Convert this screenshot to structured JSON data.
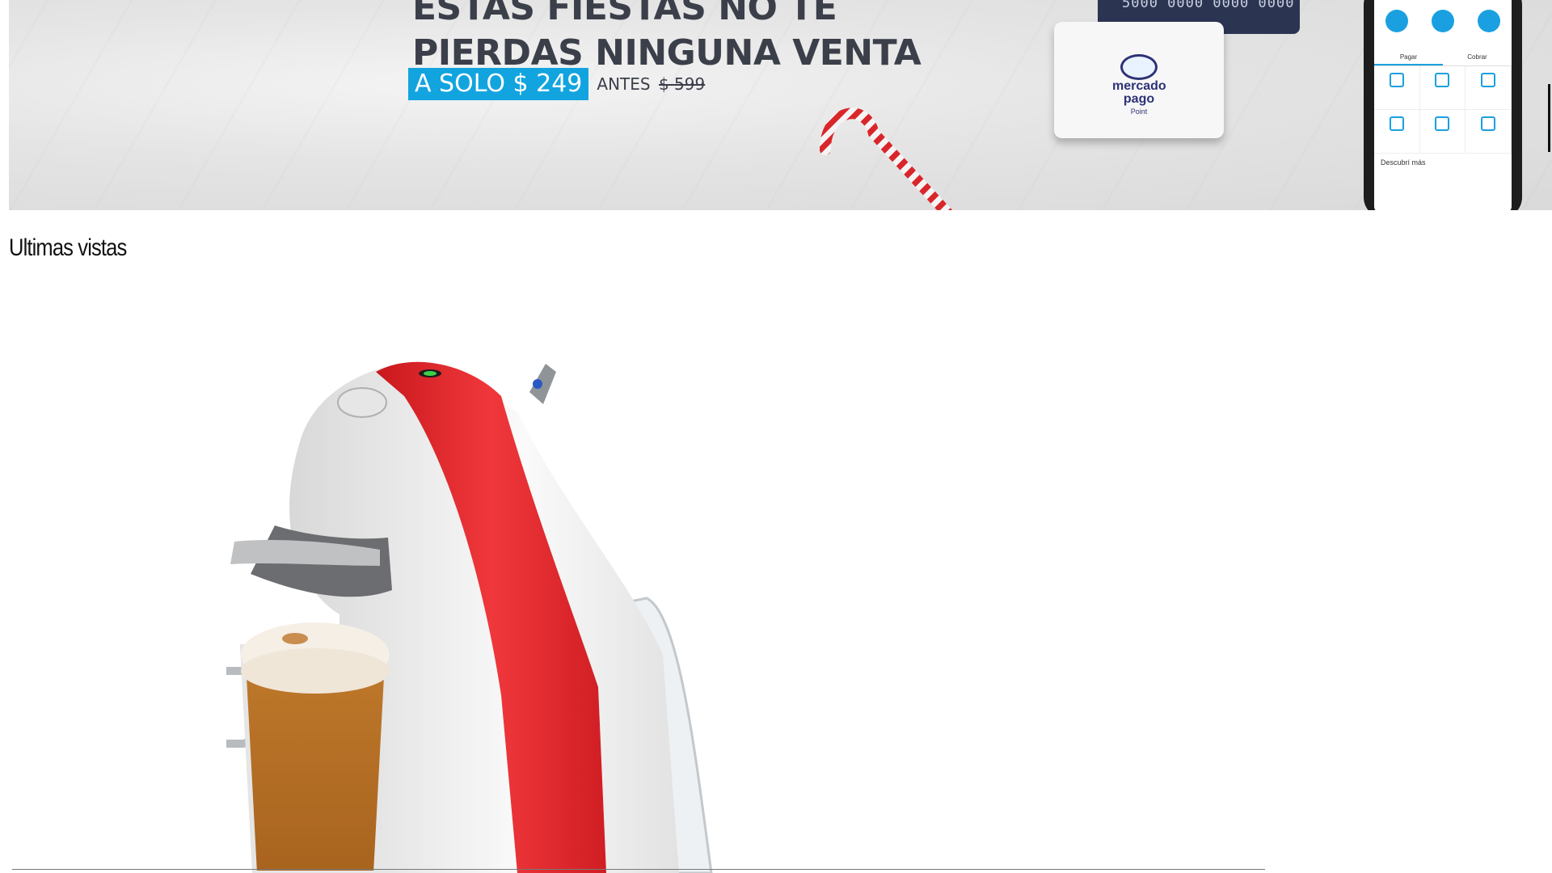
{
  "banner": {
    "headline_line1": "ESTAS FIESTAS NO TE",
    "headline_line2": "PIERDAS NINGUNA VENTA",
    "price_label": "A SOLO $ 249",
    "before_label": "ANTES",
    "before_price": "$ 599",
    "card_number": "5000 0000 0000 0000",
    "device_brand": "mercado",
    "device_brand2": "pago",
    "device_model": "Point",
    "phone_tab_pay": "Pagar",
    "phone_tab_charge": "Cobrar",
    "phone_discover": "Descubrí más"
  },
  "section": {
    "title": "Ultimas vistas"
  },
  "product": {
    "image_name": "Cafetera Dolce Gusto Mini Me roja con taza de café"
  },
  "colors": {
    "accent": "#12a4df",
    "machine_red": "#e8262b",
    "text": "#111111"
  }
}
